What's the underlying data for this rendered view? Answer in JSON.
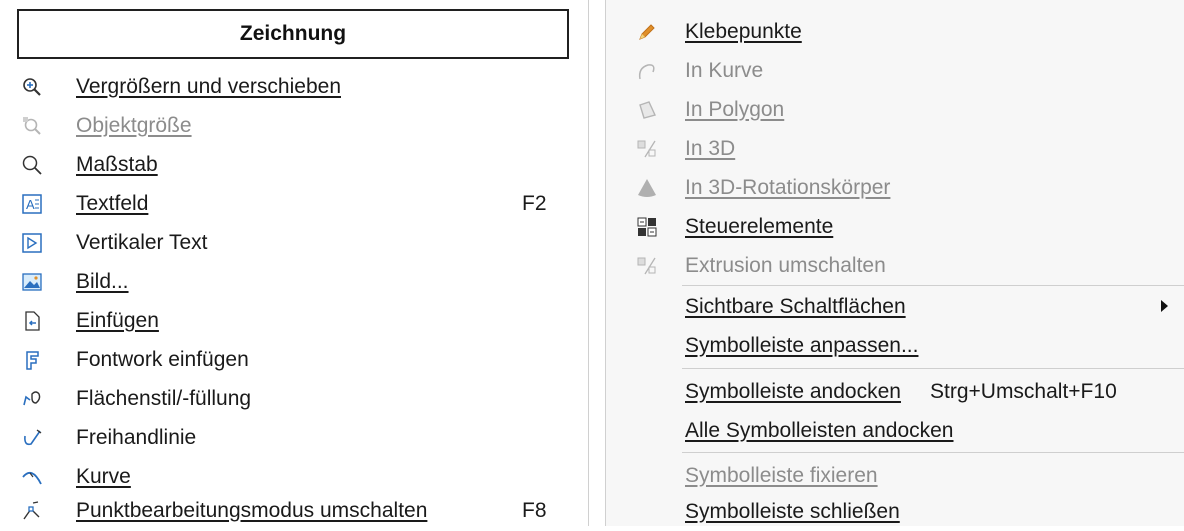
{
  "left_menu": {
    "header": "Zeichnung",
    "items": [
      {
        "label": "Vergrößern und verschieben",
        "shortcut": "",
        "disabled": false,
        "icon": "zoom-pan-icon"
      },
      {
        "label": "Objektgröße",
        "shortcut": "",
        "disabled": true,
        "icon": "object-zoom-icon"
      },
      {
        "label": "Maßstab",
        "shortcut": "",
        "disabled": false,
        "icon": "zoom-icon"
      },
      {
        "label": "Textfeld",
        "shortcut": "F2",
        "disabled": false,
        "icon": "text-box-icon"
      },
      {
        "label": "Vertikaler Text",
        "shortcut": "",
        "disabled": false,
        "icon": "vertical-text-icon"
      },
      {
        "label": "Bild...",
        "shortcut": "",
        "disabled": false,
        "icon": "image-icon"
      },
      {
        "label": "Einfügen",
        "shortcut": "",
        "disabled": false,
        "icon": "insert-icon"
      },
      {
        "label": "Fontwork einfügen",
        "shortcut": "",
        "disabled": false,
        "icon": "fontwork-icon"
      },
      {
        "label": "Flächenstil/-füllung",
        "shortcut": "",
        "disabled": false,
        "icon": "area-fill-icon"
      },
      {
        "label": "Freihandlinie",
        "shortcut": "",
        "disabled": false,
        "icon": "freehand-line-icon"
      },
      {
        "label": "Kurve",
        "shortcut": "",
        "disabled": false,
        "icon": "curve-icon"
      },
      {
        "label": "Punktbearbeitungsmodus umschalten",
        "shortcut": "F8",
        "disabled": false,
        "icon": "edit-points-icon"
      }
    ]
  },
  "right_menu": {
    "items": [
      {
        "label": "Klebepunkte",
        "shortcut": "",
        "disabled": false,
        "icon": "glue-points-icon"
      },
      {
        "label": "In Kurve",
        "shortcut": "",
        "disabled": true,
        "icon": "to-curve-icon"
      },
      {
        "label": "In Polygon",
        "shortcut": "",
        "disabled": true,
        "icon": "to-polygon-icon"
      },
      {
        "label": "In 3D",
        "shortcut": "",
        "disabled": true,
        "icon": "to-3d-icon"
      },
      {
        "label": "In 3D-Rotationskörper",
        "shortcut": "",
        "disabled": true,
        "icon": "rotation-body-icon"
      },
      {
        "label": "Steuerelemente",
        "shortcut": "",
        "disabled": false,
        "icon": "form-controls-icon"
      },
      {
        "label": "Extrusion umschalten",
        "shortcut": "",
        "disabled": true,
        "icon": "extrusion-icon"
      },
      {
        "label": "Sichtbare Schaltflächen",
        "shortcut": "",
        "disabled": false,
        "icon": ""
      },
      {
        "label": "Symbolleiste anpassen...",
        "shortcut": "",
        "disabled": false,
        "icon": ""
      },
      {
        "label": "Symbolleiste andocken",
        "shortcut": "Strg+Umschalt+F10",
        "disabled": false,
        "icon": ""
      },
      {
        "label": "Alle Symbolleisten andocken",
        "shortcut": "",
        "disabled": false,
        "icon": ""
      },
      {
        "label": "Symbolleiste fixieren",
        "shortcut": "",
        "disabled": true,
        "icon": ""
      },
      {
        "label": "Symbolleiste schließen",
        "shortcut": "",
        "disabled": false,
        "icon": ""
      }
    ]
  },
  "colors": {
    "text": "#1a1a1a",
    "disabled_text": "#8c8c8c",
    "icon_blue": "#2a6fbf",
    "icon_orange": "#e0902a",
    "separator": "#cfcfcf"
  }
}
